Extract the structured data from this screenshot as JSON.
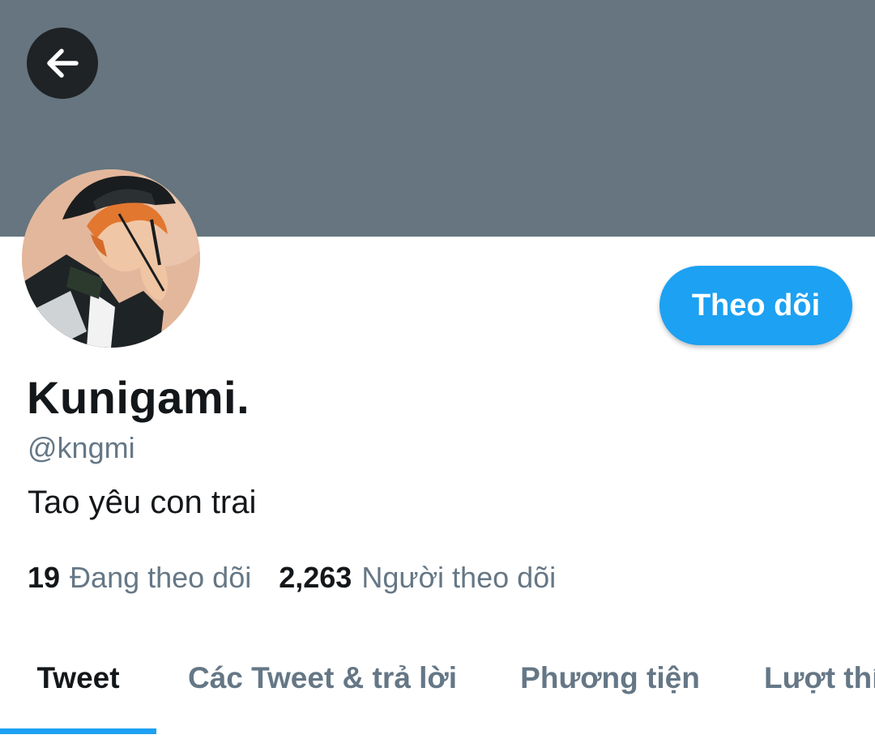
{
  "header": {
    "back_icon": "arrow-left-icon",
    "banner_color": "#66757f"
  },
  "profile": {
    "display_name": "Kunigami.",
    "handle": "@kngmi",
    "bio": "Tao yêu con trai",
    "follow_label": "Theo dõi",
    "accent_color": "#1da1f2"
  },
  "stats": [
    {
      "count": "19",
      "label": "Đang theo dõi"
    },
    {
      "count": "2,263",
      "label": "Người theo dõi"
    }
  ],
  "tabs": [
    {
      "label": "Tweet",
      "active": true
    },
    {
      "label": "Các Tweet & trả lời",
      "active": false
    },
    {
      "label": "Phương tiện",
      "active": false
    },
    {
      "label": "Lượt thích",
      "active": false
    }
  ]
}
